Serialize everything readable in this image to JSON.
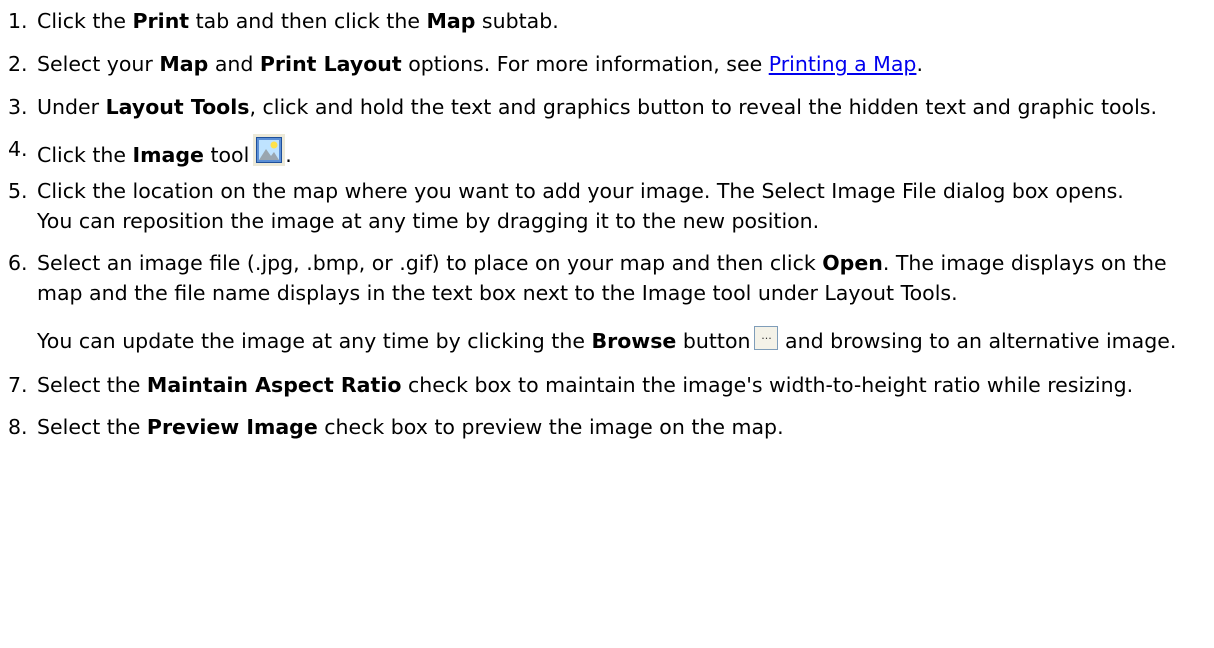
{
  "steps": [
    {
      "num": "1.",
      "parts": [
        "Click the ",
        "Print",
        " tab and then click the ",
        "Map",
        " subtab."
      ]
    },
    {
      "num": "2.",
      "parts": [
        "Select your ",
        "Map",
        " and ",
        "Print Layout",
        " options. For more information, see ",
        "Printing a Map",
        "."
      ]
    },
    {
      "num": "3.",
      "parts": [
        "Under ",
        "Layout Tools",
        ", click and hold the text and graphics button to reveal the hidden text and graphic tools."
      ]
    },
    {
      "num": "4.",
      "parts": [
        "Click the ",
        "Image",
        " tool",
        "."
      ],
      "icon": "image-tool-icon"
    },
    {
      "num": "5.",
      "parts": [
        "Click the location on the map where you want to add your image. The Select Image File dialog box opens."
      ],
      "note": "You can reposition the image at any time by dragging it to the new position."
    },
    {
      "num": "6.",
      "parts": [
        "Select an image file (.jpg, .bmp, or .gif) to place on your map and then click ",
        "Open",
        ". The image displays on the map and the file name displays in the text box next to the Image tool under Layout Tools."
      ],
      "note_parts": [
        "You can update the image at any time by clicking the ",
        "Browse",
        " button",
        "and browsing to an alternative image."
      ],
      "icon": "browse-button-icon",
      "browse_glyph": "..."
    },
    {
      "num": "7.",
      "parts": [
        "Select the ",
        "Maintain Aspect Ratio",
        " check box to maintain the image's width-to-height ratio while resizing."
      ]
    },
    {
      "num": "8.",
      "parts": [
        "Select the ",
        "Preview Image",
        " check box to preview the image on the map."
      ]
    }
  ],
  "colors": {
    "link": "#0000ee",
    "text": "#000000",
    "background": "#ffffff"
  }
}
